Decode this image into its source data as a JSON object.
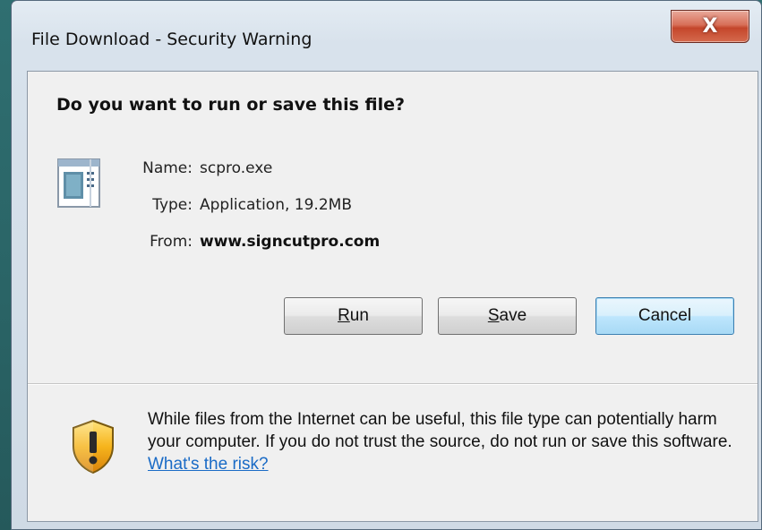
{
  "window": {
    "title": "File Download - Security Warning",
    "close_glyph": "X"
  },
  "dialog": {
    "heading": "Do you want to run or save this file?",
    "file_icon": "application-window-icon",
    "fields": {
      "name_label": "Name:",
      "name_value": "scpro.exe",
      "type_label": "Type:",
      "type_value": "Application, 19.2MB",
      "from_label": "From:",
      "from_value": "www.signcutpro.com"
    },
    "buttons": {
      "run_mnemonic": "R",
      "run_rest": "un",
      "save_mnemonic": "S",
      "save_rest": "ave",
      "cancel": "Cancel"
    },
    "warning": {
      "icon": "shield-warning-icon",
      "text": "While files from the Internet can be useful, this file type can potentially harm your computer. If you do not trust the source, do not run or save this software. ",
      "link": "What's the risk?"
    }
  },
  "colors": {
    "desktop": "#2f6f71",
    "link": "#1a6bc6",
    "close_button": "#c4462b",
    "default_button_border": "#3c7fb1"
  }
}
